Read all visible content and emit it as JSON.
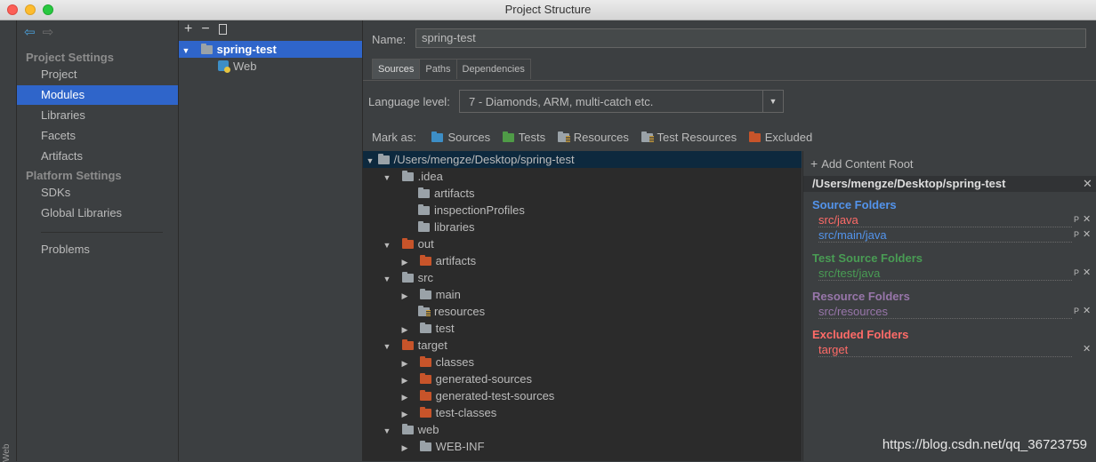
{
  "window": {
    "title": "Project Structure"
  },
  "side_strip": {
    "label": "Web"
  },
  "nav": {
    "project_settings": "Project Settings",
    "project": "Project",
    "modules": "Modules",
    "libraries": "Libraries",
    "facets": "Facets",
    "artifacts": "Artifacts",
    "platform_settings": "Platform Settings",
    "sdks": "SDKs",
    "global_libraries": "Global Libraries",
    "problems": "Problems"
  },
  "modules": {
    "toolbar": {
      "add": "+",
      "remove": "−"
    },
    "items": [
      {
        "label": "spring-test"
      },
      {
        "label": "Web"
      }
    ]
  },
  "details": {
    "name_label": "Name:",
    "name_value": "spring-test",
    "tabs": [
      "Sources",
      "Paths",
      "Dependencies"
    ],
    "language_level_label": "Language level:",
    "language_level_value": "7 - Diamonds, ARM, multi-catch etc.",
    "mark_as_label": "Mark as:",
    "mark_as": [
      "Sources",
      "Tests",
      "Resources",
      "Test Resources",
      "Excluded"
    ]
  },
  "tree": [
    {
      "label": "/Users/mengze/Desktop/spring-test"
    },
    {
      "label": ".idea"
    },
    {
      "label": "artifacts"
    },
    {
      "label": "inspectionProfiles"
    },
    {
      "label": "libraries"
    },
    {
      "label": "out"
    },
    {
      "label": "artifacts"
    },
    {
      "label": "src"
    },
    {
      "label": "main"
    },
    {
      "label": "resources"
    },
    {
      "label": "test"
    },
    {
      "label": "target"
    },
    {
      "label": "classes"
    },
    {
      "label": "generated-sources"
    },
    {
      "label": "generated-test-sources"
    },
    {
      "label": "test-classes"
    },
    {
      "label": "web"
    },
    {
      "label": "WEB-INF"
    }
  ],
  "roots": {
    "add_content_root": "Add Content Root",
    "path": "/Users/mengze/Desktop/spring-test",
    "source_folders": "Source Folders",
    "source_items": [
      "src/java",
      "src/main/java"
    ],
    "test_source_folders": "Test Source Folders",
    "test_items": [
      "src/test/java"
    ],
    "resource_folders": "Resource Folders",
    "resource_items": [
      "src/resources"
    ],
    "excluded_folders": "Excluded Folders",
    "excluded_items": [
      "target"
    ]
  },
  "watermark": "https://blog.csdn.net/qq_36723759",
  "colors": {
    "selection": "#2f65ca",
    "sources": "#3d8ec6",
    "tests": "#4f9b47",
    "excluded": "#c7542a",
    "source_heading": "#5394ec",
    "test_heading": "#499c54",
    "resource_heading": "#9876aa",
    "excluded_heading": "#ff6b68"
  }
}
